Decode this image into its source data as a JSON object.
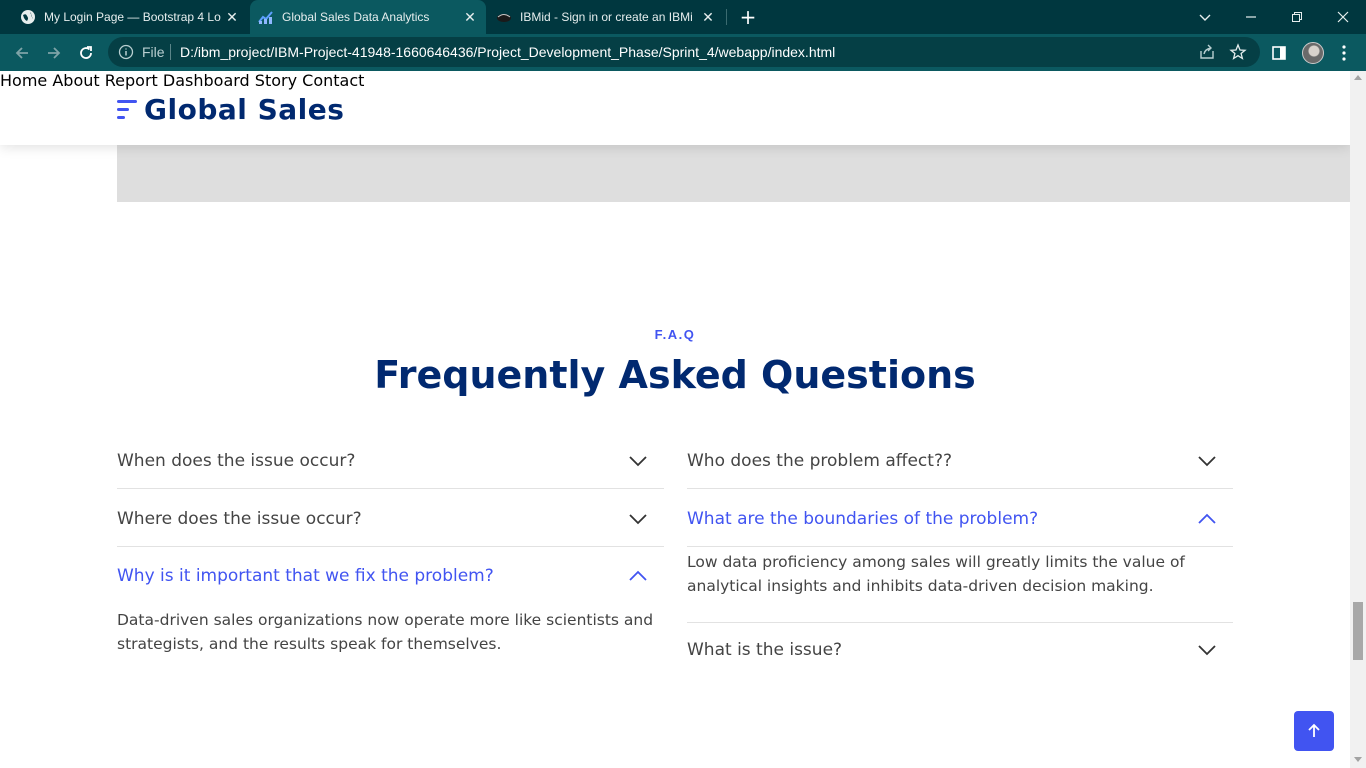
{
  "browser": {
    "tabs": [
      {
        "title": "My Login Page — Bootstrap 4 Lo",
        "close": "✕"
      },
      {
        "title": "Global Sales Data Analytics",
        "close": "✕"
      },
      {
        "title": "IBMid - Sign in or create an IBMi",
        "close": "✕"
      }
    ],
    "new_tab": "+",
    "omnibox": {
      "scheme_label": "File",
      "url": "D:/ibm_project/IBM-Project-41948-1660646436/Project_Development_Phase/Sprint_4/webapp/index.html"
    }
  },
  "site": {
    "logo_text": "Global Sales",
    "nav": [
      "Home",
      "About",
      "Report",
      "Dashboard",
      "Story",
      "Contact"
    ],
    "accent_color": "#4154f1",
    "heading_color": "#012970"
  },
  "faq": {
    "label": "F.A.Q",
    "title": "Frequently Asked Questions",
    "left": [
      {
        "question": "When does the issue occur?",
        "open": false
      },
      {
        "question": "Where does the issue occur?",
        "open": false
      },
      {
        "question": "Why is it important that we fix the problem?",
        "open": true,
        "answer": "Data-driven sales organizations now operate more like scientists and strategists, and the results speak for themselves."
      }
    ],
    "right": [
      {
        "question": "Who does the problem affect??",
        "open": false
      },
      {
        "question": "What are the boundaries of the problem?",
        "open": true,
        "answer": "Low data proficiency among sales will greatly limits the value of analytical insights and inhibits data-driven decision making."
      },
      {
        "question": "What is the issue?",
        "open": false
      }
    ]
  }
}
